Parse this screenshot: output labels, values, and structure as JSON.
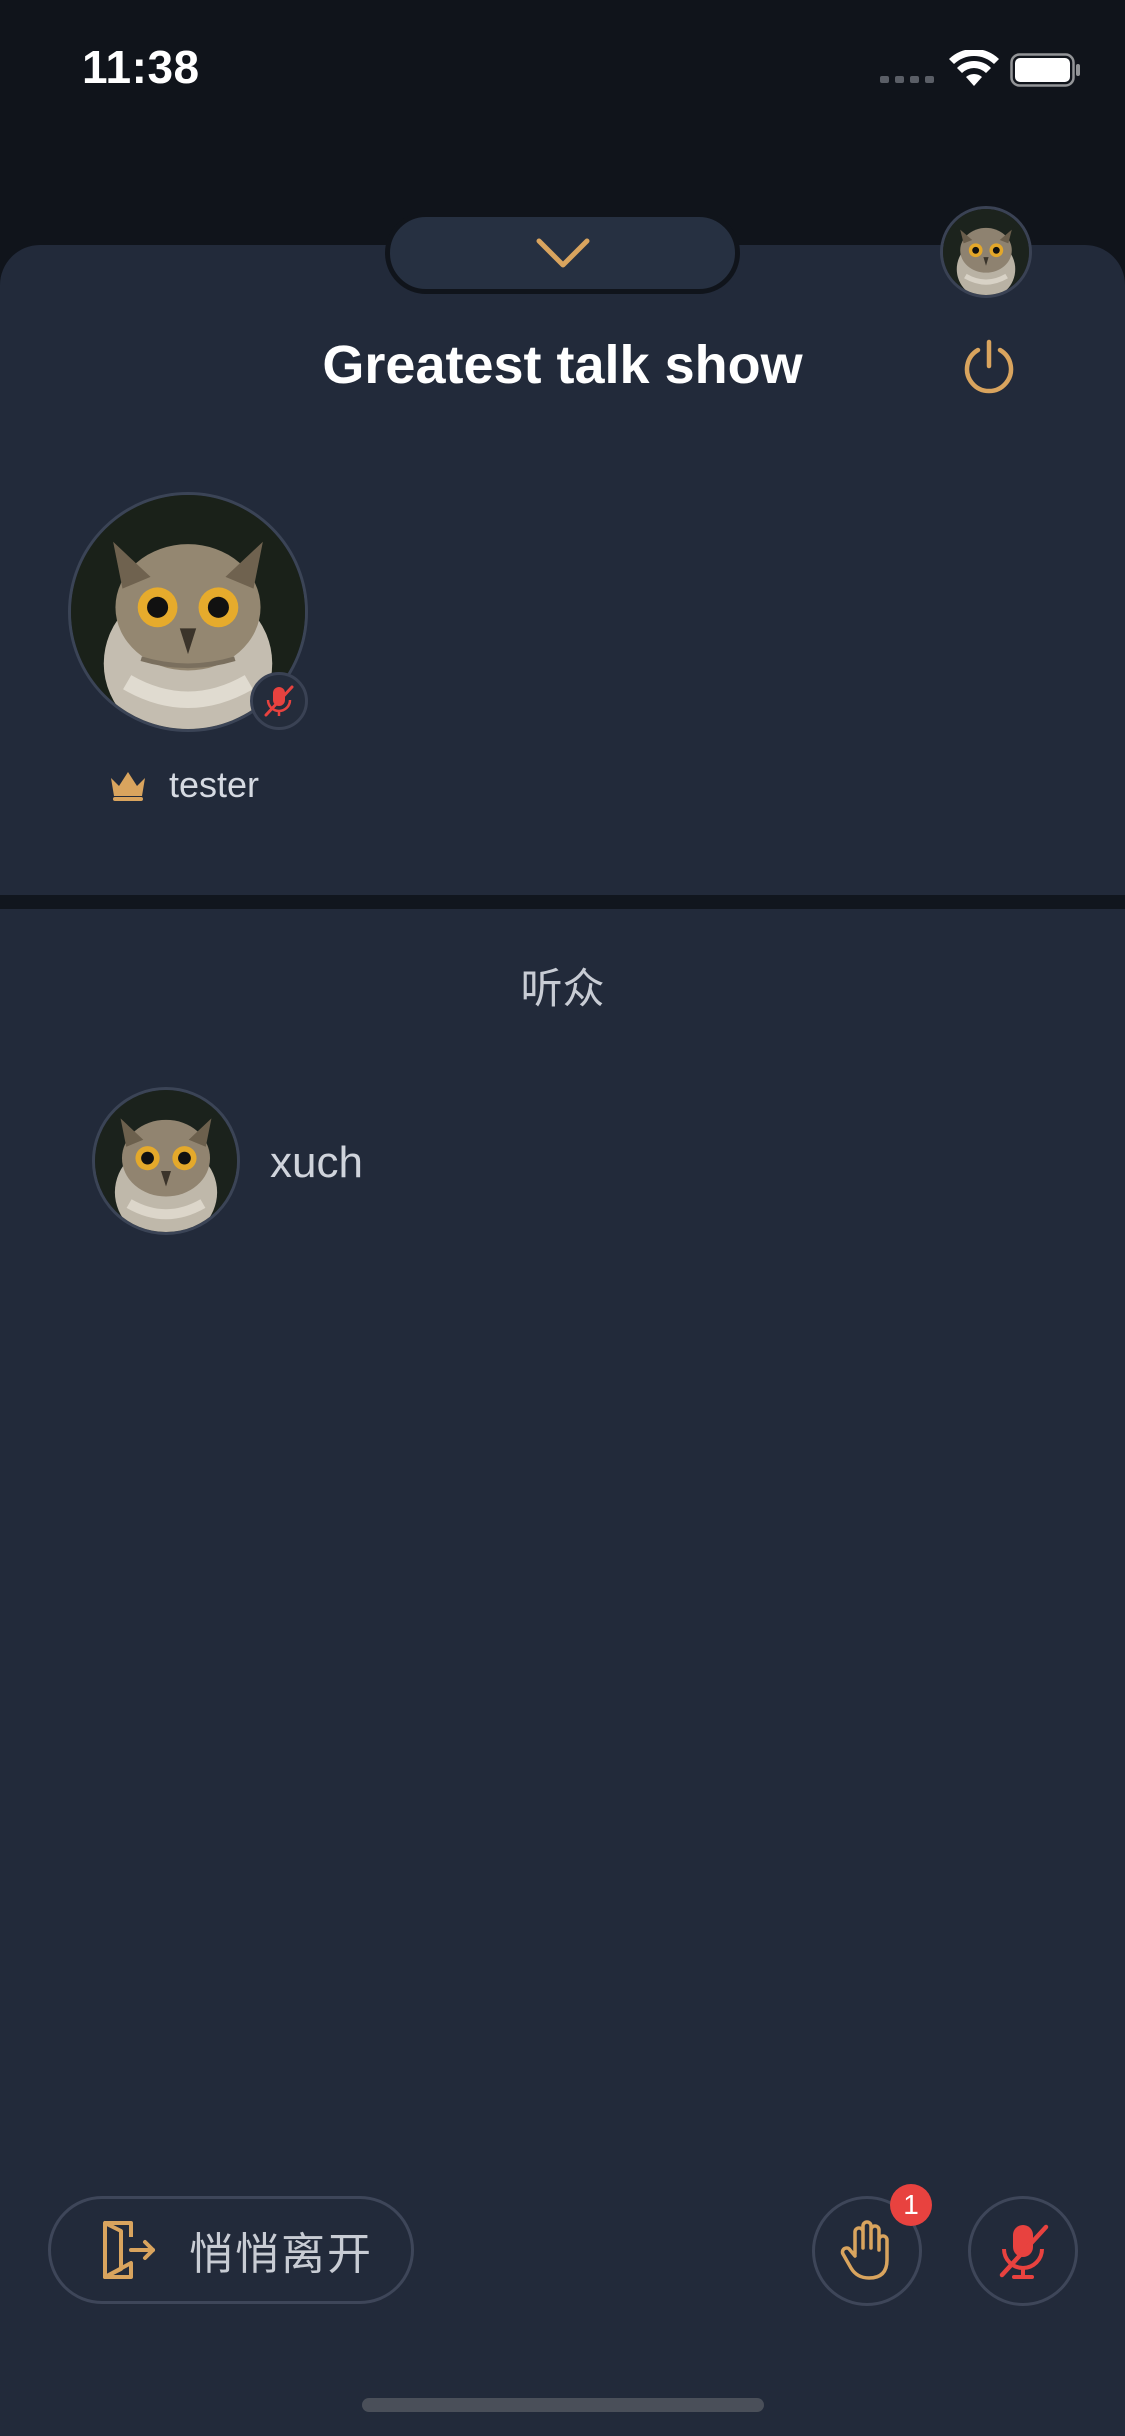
{
  "status_bar": {
    "time": "11:38"
  },
  "room": {
    "title": "Greatest talk show"
  },
  "host": {
    "name": "tester"
  },
  "audience": {
    "label": "听众",
    "listeners": [
      {
        "name": "xuch"
      }
    ]
  },
  "bottom_bar": {
    "leave_label": "悄悄离开",
    "raise_hand_badge": "1"
  },
  "colors": {
    "accent": "#d9a45e",
    "muted_red": "#e8423f",
    "sheet_bg": "#222a3a"
  }
}
